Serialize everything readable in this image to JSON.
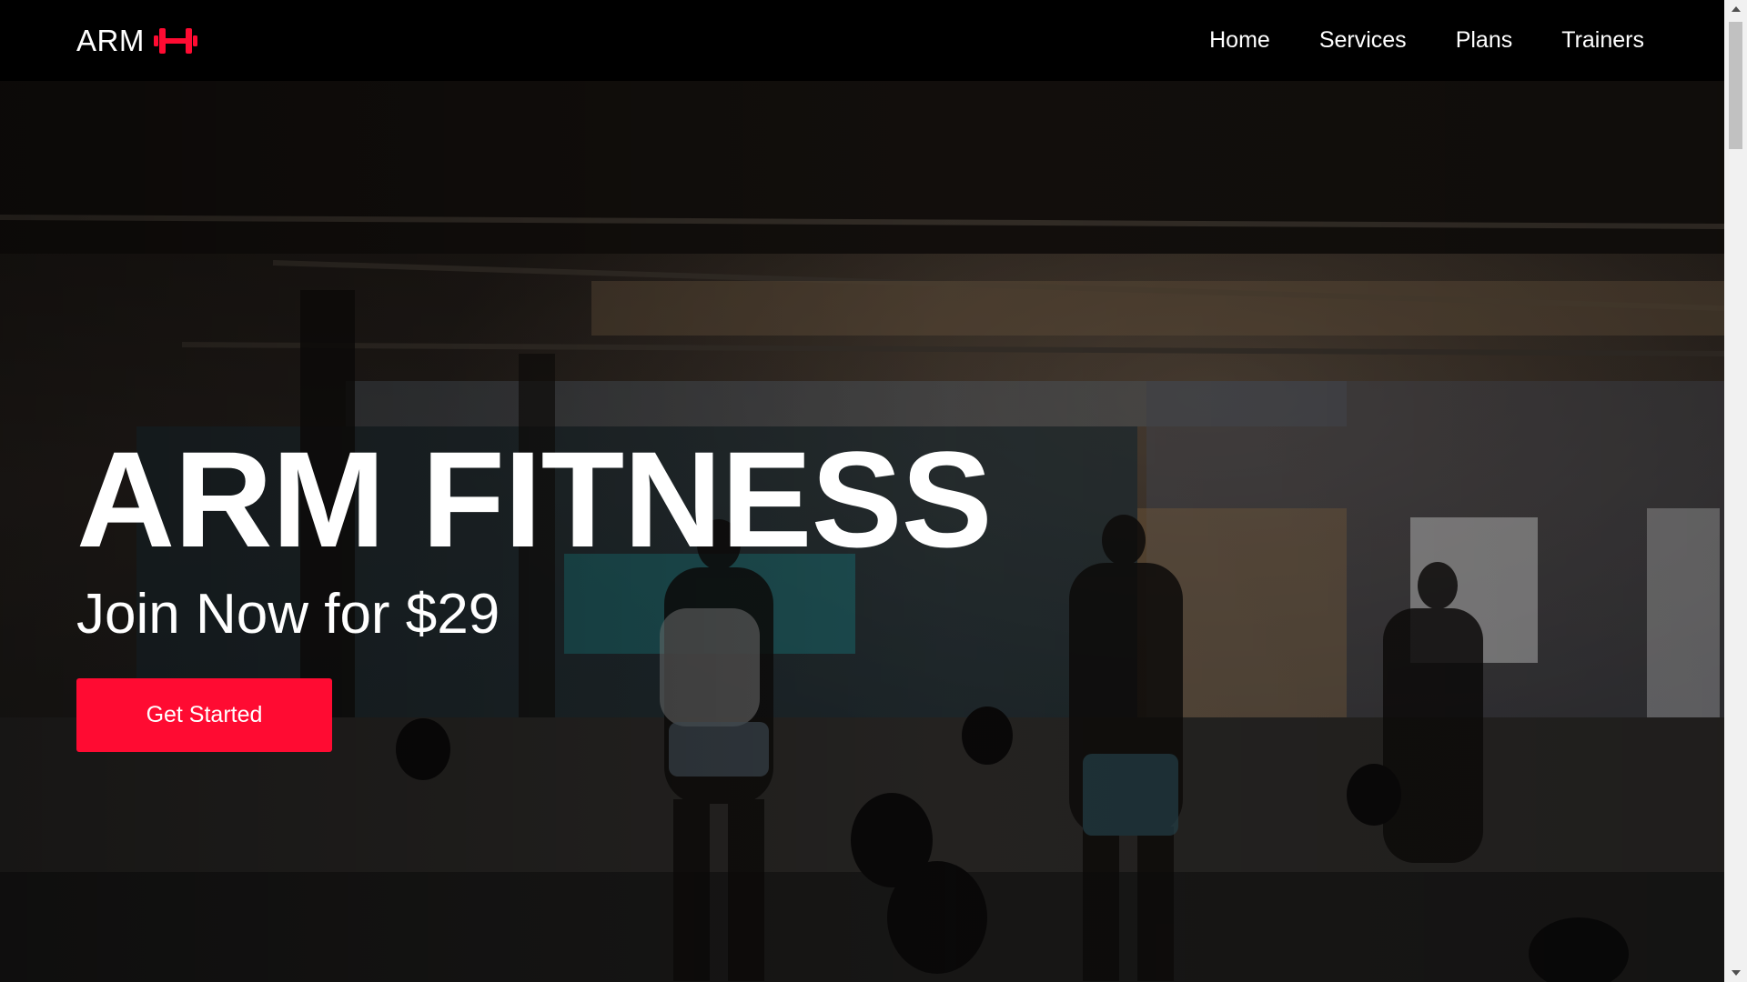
{
  "brand": {
    "name": "ARM",
    "icon": "dumbbell-icon",
    "accent": "#ff0b32"
  },
  "nav": {
    "items": [
      "Home",
      "Services",
      "Plans",
      "Trainers"
    ]
  },
  "hero": {
    "title": "ARM FITNESS",
    "subtitle": "Join Now for $29",
    "cta_label": "Get Started",
    "background": "gym-photo"
  },
  "scrollbar": {
    "position": 0
  }
}
